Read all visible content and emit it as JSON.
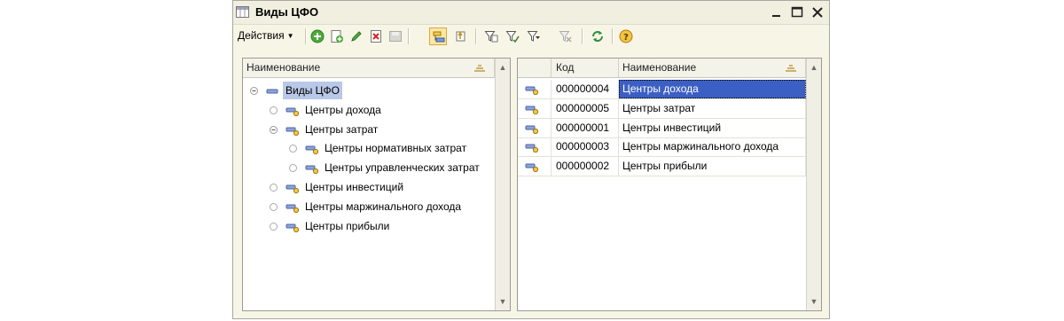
{
  "window": {
    "title": "Виды ЦФО",
    "icon": "table-window-icon",
    "controls": [
      "minimize-icon",
      "maximize-icon",
      "close-icon"
    ]
  },
  "toolbar": {
    "actions_label": "Действия",
    "buttons": [
      "add-icon",
      "copy-add-icon",
      "edit-pencil-icon",
      "delete-icon",
      "save-disabled-icon",
      "hierarchy-view-icon",
      "level-up-icon",
      "filter-icon",
      "filter-by-value-icon",
      "filter-menu-icon",
      "clear-filter-icon",
      "refresh-icon",
      "help-icon"
    ]
  },
  "tree": {
    "header": "Наименование",
    "nodes": [
      {
        "label": "Виды ЦФО",
        "level": 0,
        "toggle": "collapse",
        "selected": true
      },
      {
        "label": "Центры дохода",
        "level": 1,
        "toggle": "leaf",
        "selected": false
      },
      {
        "label": "Центры затрат",
        "level": 1,
        "toggle": "collapse",
        "selected": false
      },
      {
        "label": "Центры нормативных затрат",
        "level": 2,
        "toggle": "leaf",
        "selected": false
      },
      {
        "label": "Центры управленческих затрат",
        "level": 2,
        "toggle": "leaf",
        "selected": false
      },
      {
        "label": "Центры инвестиций",
        "level": 1,
        "toggle": "leaf",
        "selected": false
      },
      {
        "label": "Центры маржинального дохода",
        "level": 1,
        "toggle": "leaf",
        "selected": false
      },
      {
        "label": "Центры прибыли",
        "level": 1,
        "toggle": "leaf",
        "selected": false
      }
    ]
  },
  "grid": {
    "columns": [
      "Код",
      "Наименование"
    ],
    "rows": [
      {
        "code": "000000004",
        "name": "Центры дохода",
        "selected": true
      },
      {
        "code": "000000005",
        "name": "Центры затрат",
        "selected": false
      },
      {
        "code": "000000001",
        "name": "Центры инвестиций",
        "selected": false
      },
      {
        "code": "000000003",
        "name": "Центры маржинального дохода",
        "selected": false
      },
      {
        "code": "000000002",
        "name": "Центры прибыли",
        "selected": false
      }
    ]
  },
  "colors": {
    "window_bg": "#f7f5e6",
    "selection_active": "#3c5fc3",
    "selection_tree": "#b9c8e8"
  }
}
